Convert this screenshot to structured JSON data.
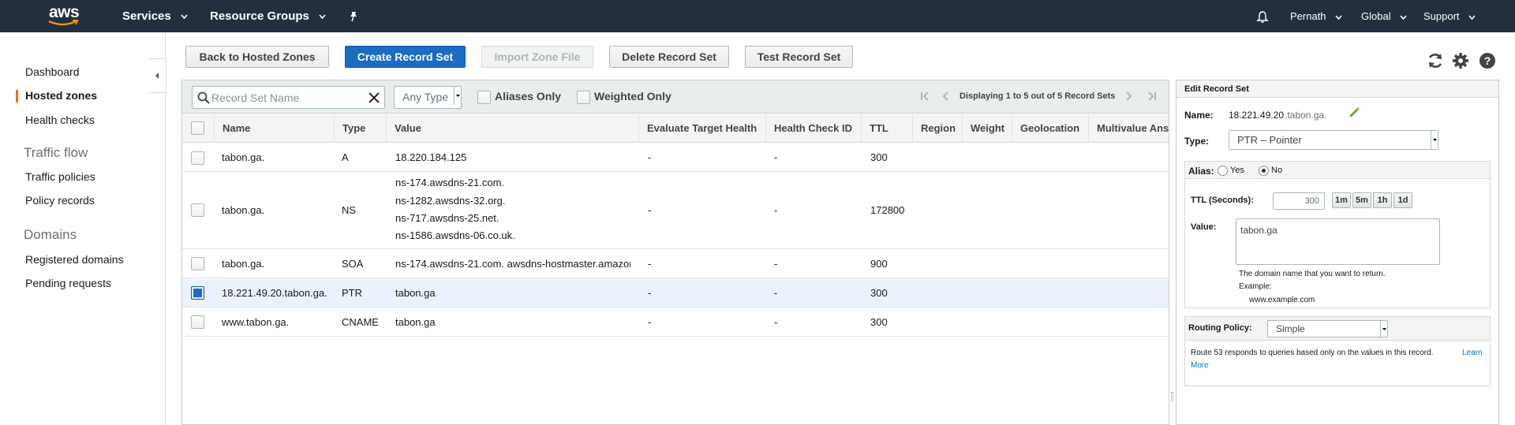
{
  "topnav": {
    "logo_text": "aws",
    "services_label": "Services",
    "resource_groups_label": "Resource Groups",
    "account_label": "Pernath",
    "region_label": "Global",
    "support_label": "Support"
  },
  "sidebar": {
    "items_top": [
      {
        "label": "Dashboard"
      },
      {
        "label": "Hosted zones",
        "active": true
      },
      {
        "label": "Health checks"
      }
    ],
    "traffic_flow": {
      "heading": "Traffic flow",
      "items": [
        {
          "label": "Traffic policies"
        },
        {
          "label": "Policy records"
        }
      ]
    },
    "domains": {
      "heading": "Domains",
      "items": [
        {
          "label": "Registered domains"
        },
        {
          "label": "Pending requests"
        }
      ]
    }
  },
  "toolbar": {
    "back_label": "Back to Hosted Zones",
    "create_label": "Create Record Set",
    "import_label": "Import Zone File",
    "delete_label": "Delete Record Set",
    "test_label": "Test Record Set"
  },
  "filter": {
    "search_placeholder": "Record Set Name",
    "type_value": "Any Type",
    "aliases_only_label": "Aliases Only",
    "weighted_only_label": "Weighted Only",
    "pager_text": "Displaying 1 to 5 out of 5 Record Sets"
  },
  "table": {
    "columns": [
      "Name",
      "Type",
      "Value",
      "Evaluate Target Health",
      "Health Check ID",
      "TTL",
      "Region",
      "Weight",
      "Geolocation",
      "Multivalue Ans"
    ],
    "rows": [
      {
        "name": "tabon.ga.",
        "type": "A",
        "values": [
          "18.220.184.125"
        ],
        "eval": "-",
        "hcid": "-",
        "ttl": "300",
        "selected": false
      },
      {
        "name": "tabon.ga.",
        "type": "NS",
        "values": [
          "ns-174.awsdns-21.com.",
          "ns-1282.awsdns-32.org.",
          "ns-717.awsdns-25.net.",
          "ns-1586.awsdns-06.co.uk."
        ],
        "eval": "-",
        "hcid": "-",
        "ttl": "172800",
        "selected": false
      },
      {
        "name": "tabon.ga.",
        "type": "SOA",
        "values": [
          "ns-174.awsdns-21.com. awsdns-hostmaster.amazon"
        ],
        "eval": "-",
        "hcid": "-",
        "ttl": "900",
        "selected": false
      },
      {
        "name": "18.221.49.20.tabon.ga.",
        "type": "PTR",
        "values": [
          "tabon.ga"
        ],
        "eval": "-",
        "hcid": "-",
        "ttl": "300",
        "selected": true
      },
      {
        "name": "www.tabon.ga.",
        "type": "CNAME",
        "values": [
          "tabon.ga"
        ],
        "eval": "-",
        "hcid": "-",
        "ttl": "300",
        "selected": false
      }
    ]
  },
  "edit_panel": {
    "title": "Edit Record Set",
    "name_label": "Name:",
    "name_value": "18.221.49.20",
    "name_suffix": ".tabon.ga.",
    "type_label": "Type:",
    "type_value": "PTR – Pointer",
    "alias_label": "Alias:",
    "alias_yes": "Yes",
    "alias_no": "No",
    "alias_selected": "No",
    "ttl_label": "TTL (Seconds):",
    "ttl_value": "300",
    "ttl_presets": [
      "1m",
      "5m",
      "1h",
      "1d"
    ],
    "value_label": "Value:",
    "value_text": "tabon.ga",
    "hint_line1": "The domain name that you want to return.",
    "hint_line2": "Example:",
    "hint_line3": "www.example.com",
    "routing_label": "Routing Policy:",
    "routing_value": "Simple",
    "routing_desc": "Route 53 responds to queries based only on the values in this record.",
    "learn_more_1": "Learn",
    "learn_more_2": "More"
  },
  "colors": {
    "nav_bg": "#232f3e",
    "primary_button": "#1a6cc4",
    "active_bar": "#ec7211",
    "link": "#0073bb"
  }
}
